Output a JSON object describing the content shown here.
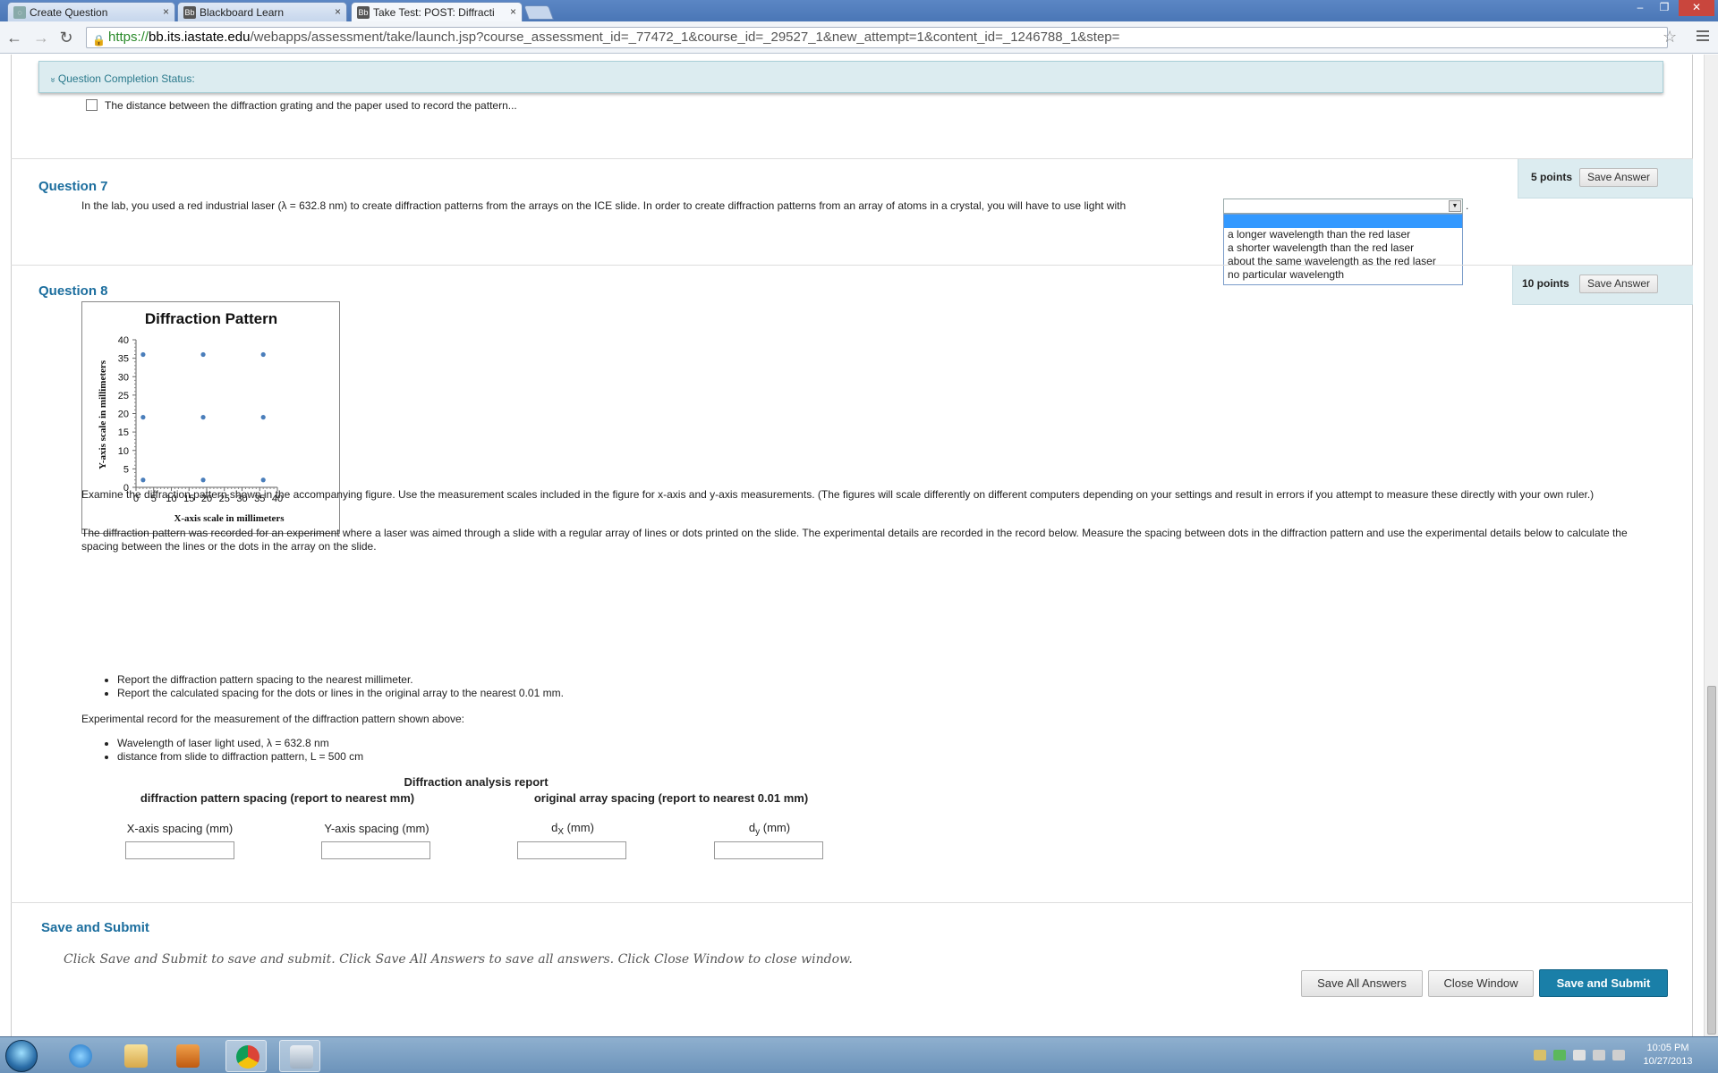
{
  "browser": {
    "tabs": [
      {
        "title": "Create Question",
        "active": false
      },
      {
        "title": "Blackboard Learn",
        "active": false
      },
      {
        "title": "Take Test: POST: Diffracti",
        "active": true
      }
    ],
    "url_scheme": "https://",
    "url_host": "bb.its.iastate.edu",
    "url_path": "/webapps/assessment/take/launch.jsp?course_assessment_id=_77472_1&course_id=_29527_1&new_attempt=1&content_id=_1246788_1&step="
  },
  "status": {
    "label": "Question Completion Status:",
    "toggle_glyph": "»"
  },
  "previous_option": {
    "text": "The distance between the diffraction grating and the paper used to record the pattern..."
  },
  "q7": {
    "title": "Question 7",
    "points": "5 points",
    "save_label": "Save Answer",
    "text": "In the lab, you used a red industrial laser (λ = 632.8 nm) to create diffraction patterns from the arrays on the ICE slide. In order to create diffraction patterns from an array of atoms in a crystal, you will have to use light with",
    "trailing": ".",
    "select_value": "",
    "options": [
      "",
      "a longer wavelength than the red laser",
      "a shorter wavelength than the red laser",
      "about the same wavelength as the red laser",
      "no particular wavelength"
    ]
  },
  "q8": {
    "title": "Question 8",
    "points": "10 points",
    "save_label": "Save Answer",
    "para1": "Examine the diffraction pattern shown in the accompanying figure.  Use the measurement scales included in the figure for x-axis and y-axis measurements.  (The figures will scale differently on different computers depending on your settings and result in errors if you attempt to measure these directly with your own ruler.)",
    "para2": "The diffraction pattern was recorded for an experiment where a laser was aimed through a slide with a regular array of lines or dots printed on the slide.  The  experimental details are recorded in the record below.  Measure the spacing between dots in the diffraction pattern and use the experimental details below to calculate the spacing between the lines or the dots in the array on the slide.",
    "instructions": [
      "Report the diffraction pattern spacing to the nearest millimeter.",
      "Report the calculated spacing for the dots or lines in the original array to the nearest 0.01 mm."
    ],
    "record_intro": "Experimental record for the measurement of the diffraction pattern shown above:",
    "record": [
      "Wavelength of laser light used, λ = 632.8 nm",
      "distance from slide to diffraction pattern, L = 500 cm"
    ],
    "report": {
      "title": "Diffraction analysis report",
      "group1": "diffraction pattern spacing (report to nearest mm)",
      "group2": "original array spacing (report to nearest 0.01 mm)",
      "x_label": "X-axis spacing (mm)",
      "y_label": "Y-axis spacing (mm)",
      "dx_main": "d",
      "dx_sub": "X",
      "dx_unit": " (mm)",
      "dy_main": "d",
      "dy_sub": "y",
      "dy_unit": " (mm)",
      "x_value": "",
      "y_value": "",
      "dx_value": "",
      "dy_value": ""
    }
  },
  "chart_data": {
    "type": "scatter",
    "title": "Diffraction Pattern",
    "xlabel": "X-axis scale in millimeters",
    "ylabel": "Y-axis scale in millimeters",
    "xlim": [
      0,
      40
    ],
    "ylim": [
      0,
      40
    ],
    "xticks": [
      0,
      5,
      10,
      15,
      20,
      25,
      30,
      35,
      40
    ],
    "yticks": [
      0,
      5,
      10,
      15,
      20,
      25,
      30,
      35,
      40
    ],
    "color": "#4a7ebb",
    "points": [
      {
        "x": 2,
        "y": 36
      },
      {
        "x": 19,
        "y": 36
      },
      {
        "x": 36,
        "y": 36
      },
      {
        "x": 2,
        "y": 19
      },
      {
        "x": 19,
        "y": 19
      },
      {
        "x": 36,
        "y": 19
      },
      {
        "x": 2,
        "y": 2
      },
      {
        "x": 19,
        "y": 2
      },
      {
        "x": 36,
        "y": 2
      }
    ]
  },
  "footer": {
    "title": "Save and Submit",
    "note": "Click Save and Submit to save and submit. Click Save All Answers to save all answers. Click Close Window to close window.",
    "save_all": "Save All Answers",
    "close": "Close Window",
    "submit": "Save and Submit"
  },
  "taskbar": {
    "time": "10:05 PM",
    "date": "10/27/2013"
  }
}
